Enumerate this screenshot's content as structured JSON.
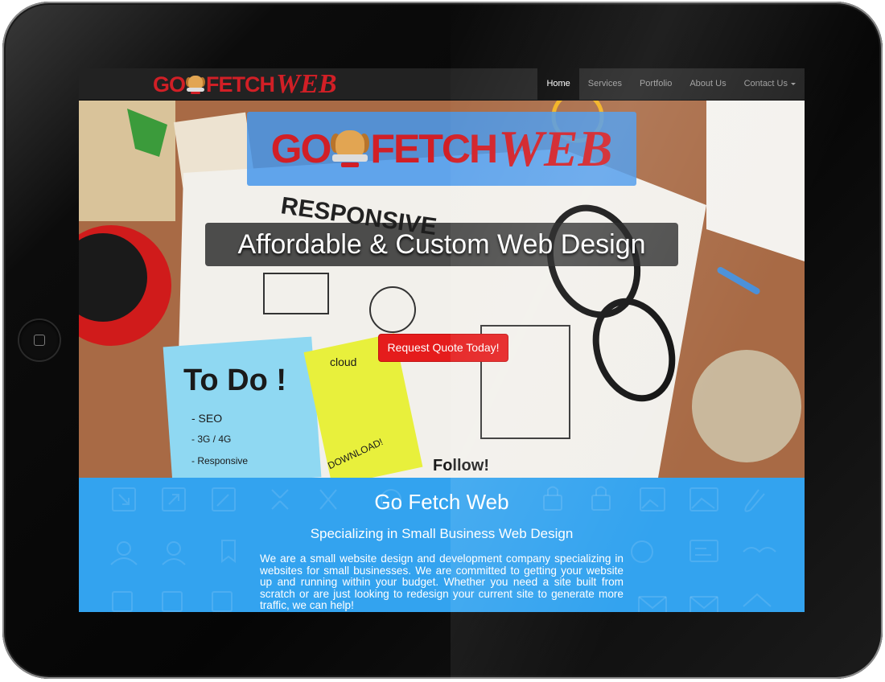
{
  "brand": {
    "go": "GO",
    "fetch": "FETCH",
    "web": "WEB",
    "color": "#d11f26"
  },
  "nav": {
    "items": [
      {
        "label": "Home",
        "active": true
      },
      {
        "label": "Services",
        "active": false
      },
      {
        "label": "Portfolio",
        "active": false
      },
      {
        "label": "About Us",
        "active": false
      },
      {
        "label": "Contact Us",
        "active": false,
        "dropdown": true
      }
    ]
  },
  "hero": {
    "tagline": "Affordable & Custom Web Design",
    "cta_label": "Request Quote Today!",
    "cta_color": "#e51c1c",
    "photo_notes": {
      "responsive": "RESPONSIVE",
      "todo": "To Do !",
      "seo": "- SEO",
      "mobile": "- 3G / 4G",
      "responsive_item": "- Responsive",
      "cloud": "cloud",
      "download": "DOWNLOAD!",
      "follow": "Follow!"
    }
  },
  "about": {
    "title": "Go Fetch Web",
    "subtitle": "Specializing in Small Business Web Design",
    "body": "We are a small website design and development company specializing in websites for small businesses. We are committed to getting your website up and running within your budget. Whether you need a site built from scratch or are just looking to redesign your current site to generate more traffic, we can help!",
    "background": "#33a3ef"
  }
}
